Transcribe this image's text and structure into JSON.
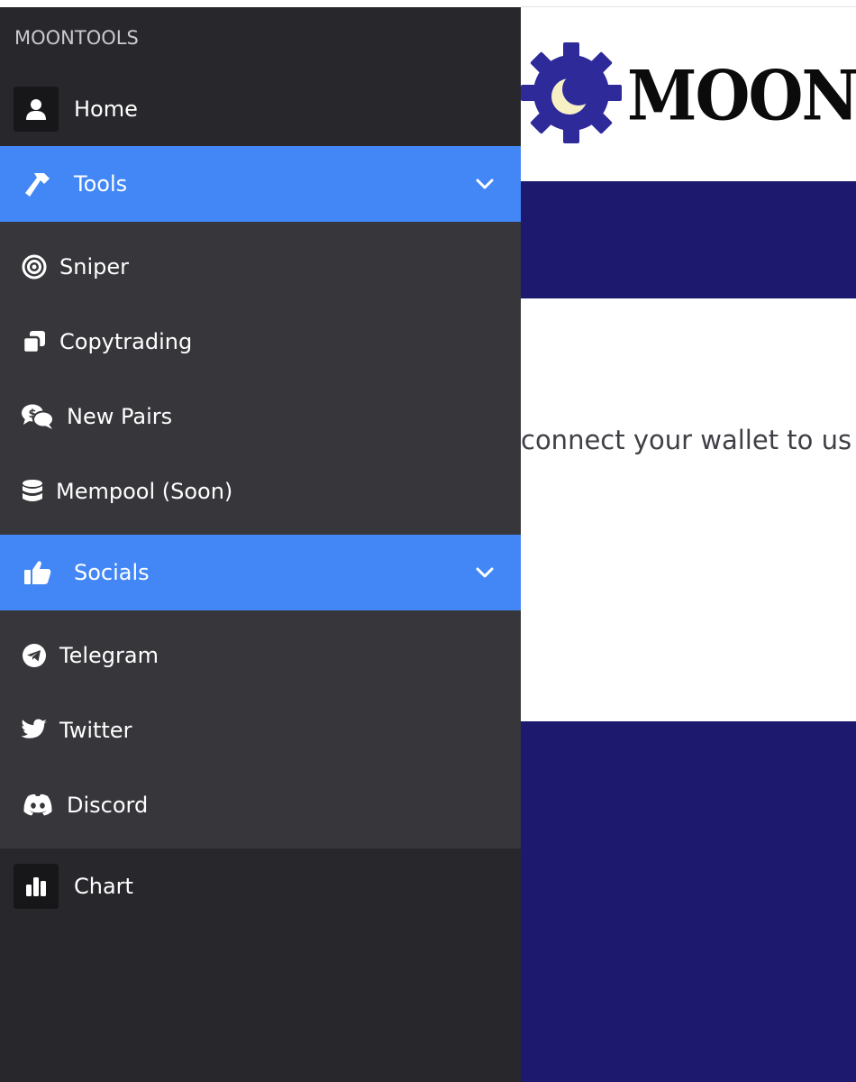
{
  "brand": "MOONTOOLS",
  "logo": {
    "wordmark": "MOONTO",
    "gear_color": "#2e2a9a",
    "moon_color": "#f6f0c4"
  },
  "main": {
    "message": "connect your wallet to us",
    "band_color": "#1c196f"
  },
  "sidebar": {
    "home": {
      "label": "Home",
      "icon": "user-icon"
    },
    "tools": {
      "label": "Tools",
      "icon": "hammer-icon",
      "expanded": true,
      "items": [
        {
          "label": "Sniper",
          "icon": "target-icon"
        },
        {
          "label": "Copytrading",
          "icon": "copy-icon"
        },
        {
          "label": "New Pairs",
          "icon": "dollar-comments-icon"
        },
        {
          "label": "Mempool (Soon)",
          "icon": "database-icon"
        }
      ]
    },
    "socials": {
      "label": "Socials",
      "icon": "thumbs-up-icon",
      "expanded": true,
      "items": [
        {
          "label": "Telegram",
          "icon": "telegram-icon"
        },
        {
          "label": "Twitter",
          "icon": "twitter-icon"
        },
        {
          "label": "Discord",
          "icon": "discord-icon"
        }
      ]
    },
    "chart": {
      "label": "Chart",
      "icon": "bar-chart-icon"
    }
  },
  "colors": {
    "sidebar_bg": "#28282c",
    "section_bg": "#4287f5",
    "group_bg": "#36363b"
  }
}
